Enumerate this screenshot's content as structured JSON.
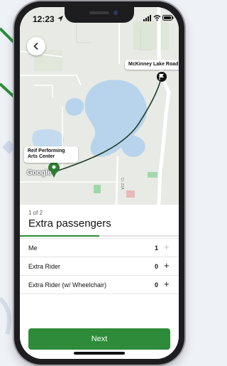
{
  "status_bar": {
    "time": "12:23"
  },
  "map": {
    "origin_label": "Reif Performing Arts Center",
    "destination_label": "McKinney Lake Road",
    "attribution": "Google",
    "road_text": "Cr. 21A"
  },
  "sheet": {
    "step": "1 of 2",
    "title": "Extra passengers",
    "progress": 0.5,
    "rows": [
      {
        "label": "Me",
        "count": "1",
        "plus": "+"
      },
      {
        "label": "Extra Rider",
        "count": "0",
        "plus": "+"
      },
      {
        "label": "Extra Rider (w/ Wheelchair)",
        "count": "0",
        "plus": "+"
      }
    ],
    "next_label": "Next"
  },
  "colors": {
    "accent": "#2e8b3a",
    "water": "#b8d4ec",
    "route": "#1f3a25"
  }
}
